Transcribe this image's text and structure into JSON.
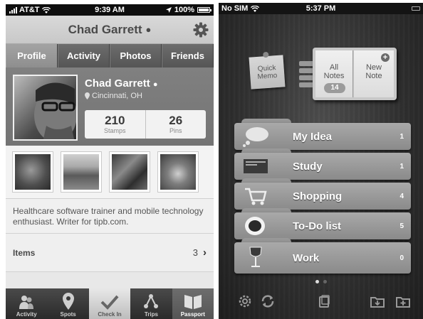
{
  "left": {
    "status": {
      "carrier": "AT&T",
      "time": "9:39 AM",
      "battery": "100%",
      "battery_level": 1.0
    },
    "title": "Chad Garrett",
    "tabs": [
      {
        "label": "Profile",
        "active": true
      },
      {
        "label": "Activity",
        "active": false
      },
      {
        "label": "Photos",
        "active": false
      },
      {
        "label": "Friends",
        "active": false
      }
    ],
    "profile": {
      "name": "Chad Garrett",
      "location": "Cincinnati, OH",
      "stats": [
        {
          "value": "210",
          "label": "Stamps"
        },
        {
          "value": "26",
          "label": "Pins"
        }
      ]
    },
    "bio": "Healthcare software trainer and mobile technology enthusiast. Writer for tipb.com.",
    "items": {
      "label": "Items",
      "count": "3"
    },
    "tabbar": [
      {
        "label": "Activity",
        "icon": "people-icon"
      },
      {
        "label": "Spots",
        "icon": "map-pin-icon"
      },
      {
        "label": "Check In",
        "icon": "checkmark-icon"
      },
      {
        "label": "Trips",
        "icon": "route-icon"
      },
      {
        "label": "Passport",
        "icon": "book-icon"
      }
    ]
  },
  "right": {
    "status": {
      "carrier": "No SIM",
      "time": "5:37 PM"
    },
    "quick_memo": {
      "line1": "Quick",
      "line2": "Memo"
    },
    "all_notes": {
      "line1": "All",
      "line2": "Notes",
      "count": "14"
    },
    "new_note": {
      "line1": "New",
      "line2": "Note"
    },
    "folders": [
      {
        "label": "My Idea",
        "count": "1",
        "icon": "thought-bubble-icon"
      },
      {
        "label": "Study",
        "count": "1",
        "icon": "book-icon"
      },
      {
        "label": "Shopping",
        "count": "4",
        "icon": "shopping-cart-icon"
      },
      {
        "label": "To-Do list",
        "count": "5",
        "icon": "coffee-cup-icon"
      },
      {
        "label": "Work",
        "count": "0",
        "icon": "wine-glass-icon"
      }
    ],
    "tools": [
      "settings-icon",
      "sync-icon",
      "view-icon",
      "folder-import-icon",
      "add-folder-icon"
    ]
  }
}
